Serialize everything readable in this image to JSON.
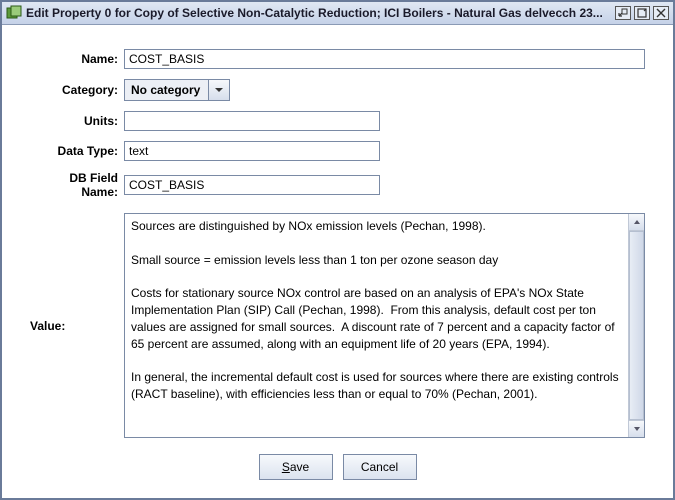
{
  "titlebar": {
    "title": "Edit Property 0 for Copy of Selective Non-Catalytic Reduction; ICI Boilers - Natural Gas delvecch 23..."
  },
  "labels": {
    "name": "Name:",
    "category": "Category:",
    "units": "Units:",
    "data_type": "Data Type:",
    "db_field_name": "DB Field Name:",
    "value": "Value:"
  },
  "fields": {
    "name": "COST_BASIS",
    "category_selected": "No category",
    "units": "",
    "data_type": "text",
    "db_field_name": "COST_BASIS",
    "value_text": "Sources are distinguished by NOx emission levels (Pechan, 1998).\n\nSmall source = emission levels less than 1 ton per ozone season day\n\nCosts for stationary source NOx control are based on an analysis of EPA's NOx State Implementation Plan (SIP) Call (Pechan, 1998).  From this analysis, default cost per ton values are assigned for small sources.  A discount rate of 7 percent and a capacity factor of 65 percent are assumed, along with an equipment life of 20 years (EPA, 1994).\n\nIn general, the incremental default cost is used for sources where there are existing controls (RACT baseline), with efficiencies less than or equal to 70% (Pechan, 2001)."
  },
  "buttons": {
    "save": "Save",
    "cancel": "Cancel"
  }
}
